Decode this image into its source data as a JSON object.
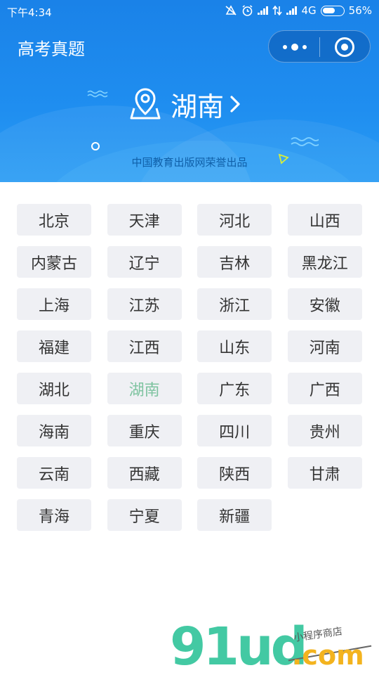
{
  "status_bar": {
    "time": "下午4:34",
    "network": "4G",
    "battery": "56%"
  },
  "header": {
    "title": "高考真题",
    "selected_province": "湖南",
    "publisher_note": "中国教育出版网荣誉出品"
  },
  "provinces": [
    "北京",
    "天津",
    "河北",
    "山西",
    "内蒙古",
    "辽宁",
    "吉林",
    "黑龙江",
    "上海",
    "江苏",
    "浙江",
    "安徽",
    "福建",
    "江西",
    "山东",
    "河南",
    "湖北",
    "湖南",
    "广东",
    "广西",
    "海南",
    "重庆",
    "四川",
    "贵州",
    "云南",
    "西藏",
    "陕西",
    "甘肃",
    "青海",
    "宁夏",
    "新疆"
  ],
  "active_province": "湖南",
  "watermark": {
    "logo": "91ud",
    "domain": ".com",
    "tagline": "小程序商店"
  },
  "colors": {
    "header_blue": "#1f8ef0",
    "chip_bg": "#eff0f4",
    "active_green": "#7ec3a0",
    "text_dark": "#333333"
  }
}
